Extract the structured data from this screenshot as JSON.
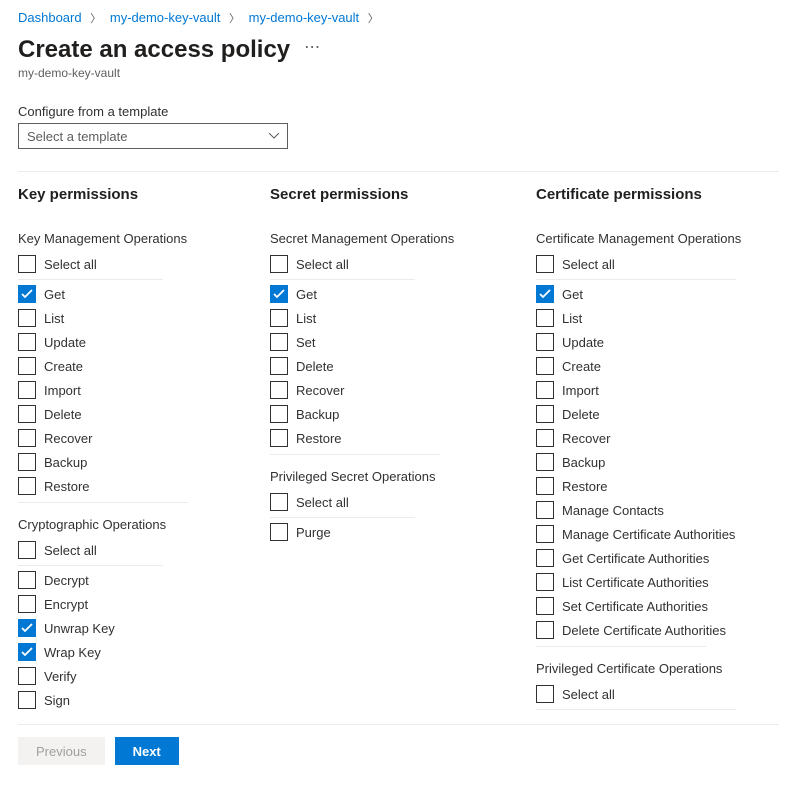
{
  "breadcrumb": [
    {
      "label": "Dashboard"
    },
    {
      "label": "my-demo-key-vault"
    },
    {
      "label": "my-demo-key-vault"
    }
  ],
  "page_title": "Create an access policy",
  "subtitle": "my-demo-key-vault",
  "template": {
    "label": "Configure from a template",
    "placeholder": "Select a template"
  },
  "select_all_label": "Select all",
  "columns": {
    "key": {
      "heading": "Key permissions",
      "groups": [
        {
          "heading": "Key Management Operations",
          "items": [
            {
              "label": "Get",
              "checked": true
            },
            {
              "label": "List",
              "checked": false
            },
            {
              "label": "Update",
              "checked": false
            },
            {
              "label": "Create",
              "checked": false
            },
            {
              "label": "Import",
              "checked": false
            },
            {
              "label": "Delete",
              "checked": false
            },
            {
              "label": "Recover",
              "checked": false
            },
            {
              "label": "Backup",
              "checked": false
            },
            {
              "label": "Restore",
              "checked": false
            }
          ]
        },
        {
          "heading": "Cryptographic Operations",
          "items": [
            {
              "label": "Decrypt",
              "checked": false
            },
            {
              "label": "Encrypt",
              "checked": false
            },
            {
              "label": "Unwrap Key",
              "checked": true
            },
            {
              "label": "Wrap Key",
              "checked": true
            },
            {
              "label": "Verify",
              "checked": false
            },
            {
              "label": "Sign",
              "checked": false
            }
          ]
        }
      ]
    },
    "secret": {
      "heading": "Secret permissions",
      "groups": [
        {
          "heading": "Secret Management Operations",
          "items": [
            {
              "label": "Get",
              "checked": true
            },
            {
              "label": "List",
              "checked": false
            },
            {
              "label": "Set",
              "checked": false
            },
            {
              "label": "Delete",
              "checked": false
            },
            {
              "label": "Recover",
              "checked": false
            },
            {
              "label": "Backup",
              "checked": false
            },
            {
              "label": "Restore",
              "checked": false
            }
          ]
        },
        {
          "heading": "Privileged Secret Operations",
          "items": [
            {
              "label": "Purge",
              "checked": false
            }
          ]
        }
      ]
    },
    "certificate": {
      "heading": "Certificate permissions",
      "groups": [
        {
          "heading": "Certificate Management Operations",
          "items": [
            {
              "label": "Get",
              "checked": true
            },
            {
              "label": "List",
              "checked": false
            },
            {
              "label": "Update",
              "checked": false
            },
            {
              "label": "Create",
              "checked": false
            },
            {
              "label": "Import",
              "checked": false
            },
            {
              "label": "Delete",
              "checked": false
            },
            {
              "label": "Recover",
              "checked": false
            },
            {
              "label": "Backup",
              "checked": false
            },
            {
              "label": "Restore",
              "checked": false
            },
            {
              "label": "Manage Contacts",
              "checked": false
            },
            {
              "label": "Manage Certificate Authorities",
              "checked": false
            },
            {
              "label": "Get Certificate Authorities",
              "checked": false
            },
            {
              "label": "List Certificate Authorities",
              "checked": false
            },
            {
              "label": "Set Certificate Authorities",
              "checked": false
            },
            {
              "label": "Delete Certificate Authorities",
              "checked": false
            }
          ]
        },
        {
          "heading": "Privileged Certificate Operations",
          "items": []
        }
      ]
    }
  },
  "footer": {
    "previous": "Previous",
    "next": "Next"
  }
}
